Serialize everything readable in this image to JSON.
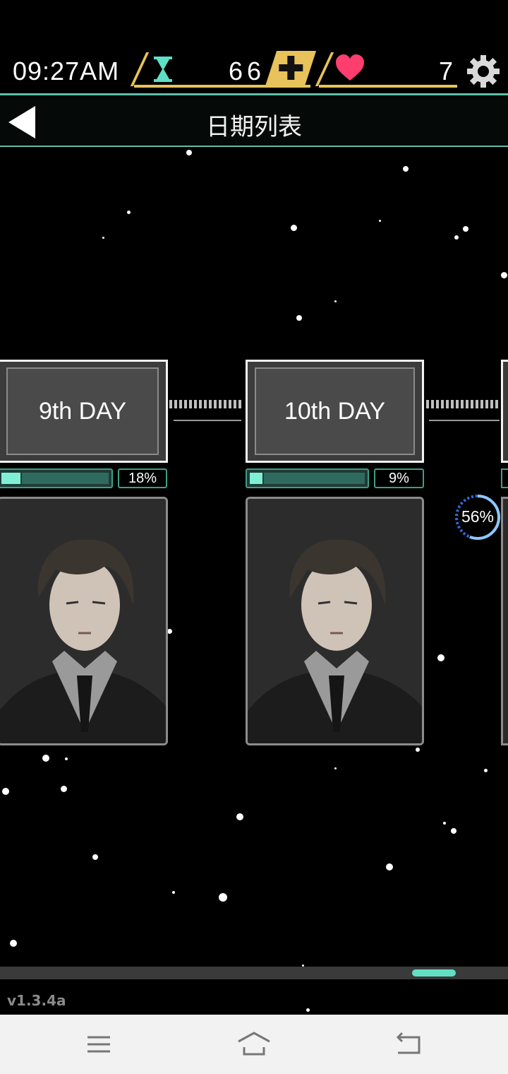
{
  "status": {
    "clock": "09:27AM",
    "hourglass_count": "66",
    "hearts_count": "7",
    "colors": {
      "gold": "#e8c25a",
      "teal": "#5fbfa8",
      "heart": "#ff3d6e"
    }
  },
  "header": {
    "title": "日期列表",
    "back_icon": "back-triangle-icon"
  },
  "days": [
    {
      "label": "9th DAY",
      "progress": 0.18,
      "progress_text": "18%"
    },
    {
      "label": "10th DAY",
      "progress": 0.09,
      "progress_text": "9%"
    }
  ],
  "loading": {
    "percent_text": "56%",
    "progress": 0.56
  },
  "footer": {
    "version": "v1.3.4a"
  },
  "system_nav": {
    "icons": [
      "menu-icon",
      "home-icon",
      "back-icon"
    ]
  }
}
